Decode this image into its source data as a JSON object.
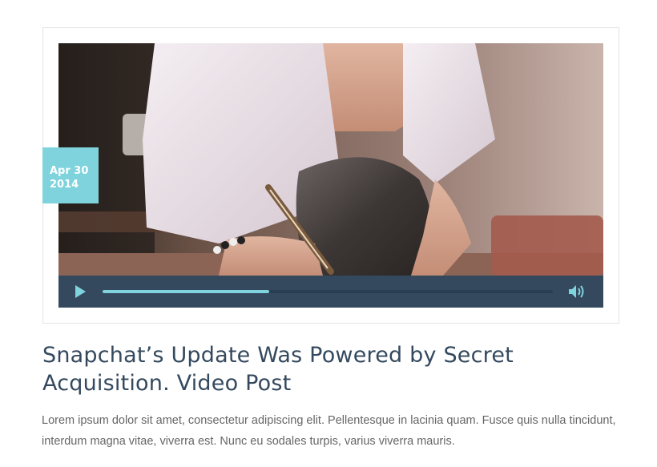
{
  "post": {
    "date_badge": {
      "month_day": "Apr 30",
      "year": "2014"
    },
    "title": "Snapchat’s Update Was Powered by Secret Acquisition. Video Post",
    "excerpt": "Lorem ipsum dolor sit amet, consectetur adipiscing elit. Pellentesque in lacinia quam. Fusce quis nulla tincidunt, interdum magna vitae, viverra est. Nunc eu sodales turpis, varius viverra mauris."
  },
  "video_player": {
    "progress": 0.37,
    "icons": {
      "play": "play-icon",
      "volume": "volume-icon"
    }
  },
  "colors": {
    "accent": "#7fd3dc",
    "controls_bg": "#34495e",
    "title": "#34495e",
    "body_text": "#666666"
  }
}
